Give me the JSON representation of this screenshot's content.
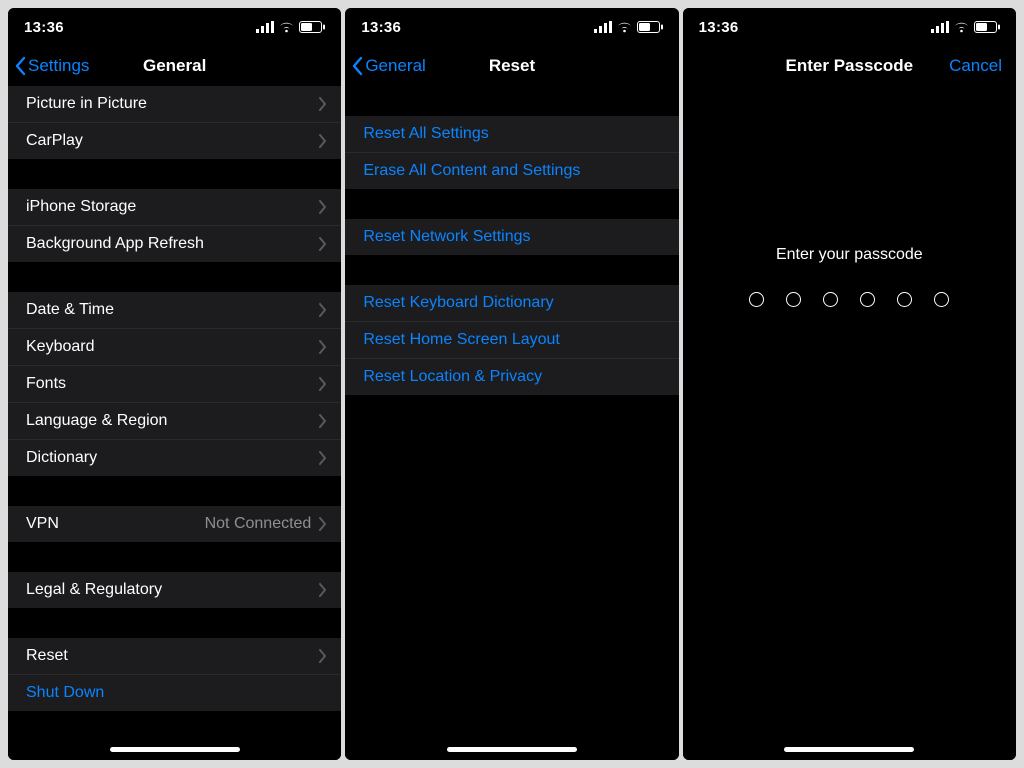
{
  "status": {
    "time": "13:36"
  },
  "screen1": {
    "back": "Settings",
    "title": "General",
    "rows": {
      "group0": [
        {
          "label": "Picture in Picture"
        },
        {
          "label": "CarPlay"
        }
      ],
      "group1": [
        {
          "label": "iPhone Storage"
        },
        {
          "label": "Background App Refresh"
        }
      ],
      "group2": [
        {
          "label": "Date & Time"
        },
        {
          "label": "Keyboard"
        },
        {
          "label": "Fonts"
        },
        {
          "label": "Language & Region"
        },
        {
          "label": "Dictionary"
        }
      ],
      "group3": [
        {
          "label": "VPN",
          "detail": "Not Connected"
        }
      ],
      "group4": [
        {
          "label": "Legal & Regulatory"
        }
      ],
      "group5": [
        {
          "label": "Reset"
        },
        {
          "label": "Shut Down",
          "action": true
        }
      ]
    }
  },
  "screen2": {
    "back": "General",
    "title": "Reset",
    "rows": {
      "group0": [
        {
          "label": "Reset All Settings"
        },
        {
          "label": "Erase All Content and Settings"
        }
      ],
      "group1": [
        {
          "label": "Reset Network Settings"
        }
      ],
      "group2": [
        {
          "label": "Reset Keyboard Dictionary"
        },
        {
          "label": "Reset Home Screen Layout"
        },
        {
          "label": "Reset Location & Privacy"
        }
      ]
    }
  },
  "screen3": {
    "title": "Enter Passcode",
    "cancel": "Cancel",
    "prompt": "Enter your passcode",
    "dot_count": 6
  }
}
